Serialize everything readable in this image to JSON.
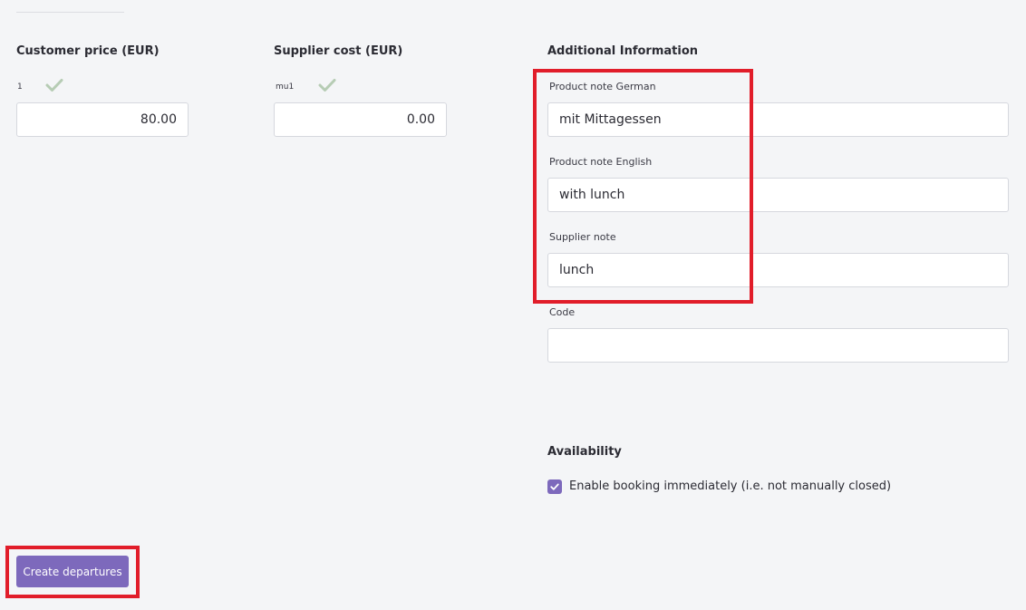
{
  "customer_price": {
    "heading": "Customer price (EUR)",
    "row_label": "1",
    "value": "80.00"
  },
  "supplier_cost": {
    "heading": "Supplier cost (EUR)",
    "row_label": "mu1",
    "value": "0.00"
  },
  "additional_information": {
    "heading": "Additional Information",
    "product_note_german": {
      "label": "Product note German",
      "value": "mit Mittagessen"
    },
    "product_note_english": {
      "label": "Product note English",
      "value": "with lunch"
    },
    "supplier_note": {
      "label": "Supplier note",
      "value": "lunch"
    },
    "code": {
      "label": "Code",
      "value": ""
    }
  },
  "availability": {
    "heading": "Availability",
    "enable_booking_label": "Enable booking immediately (i.e. not manually closed)",
    "enable_booking_checked": true
  },
  "actions": {
    "create_departures_label": "Create departures"
  },
  "colors": {
    "accent": "#7d69bc",
    "check_green": "#b6ccb4",
    "highlight_red": "#e11d2a",
    "background": "#f4f5f7"
  },
  "icons": {
    "check": "check-icon",
    "checkbox_check": "checkbox-check-icon"
  }
}
